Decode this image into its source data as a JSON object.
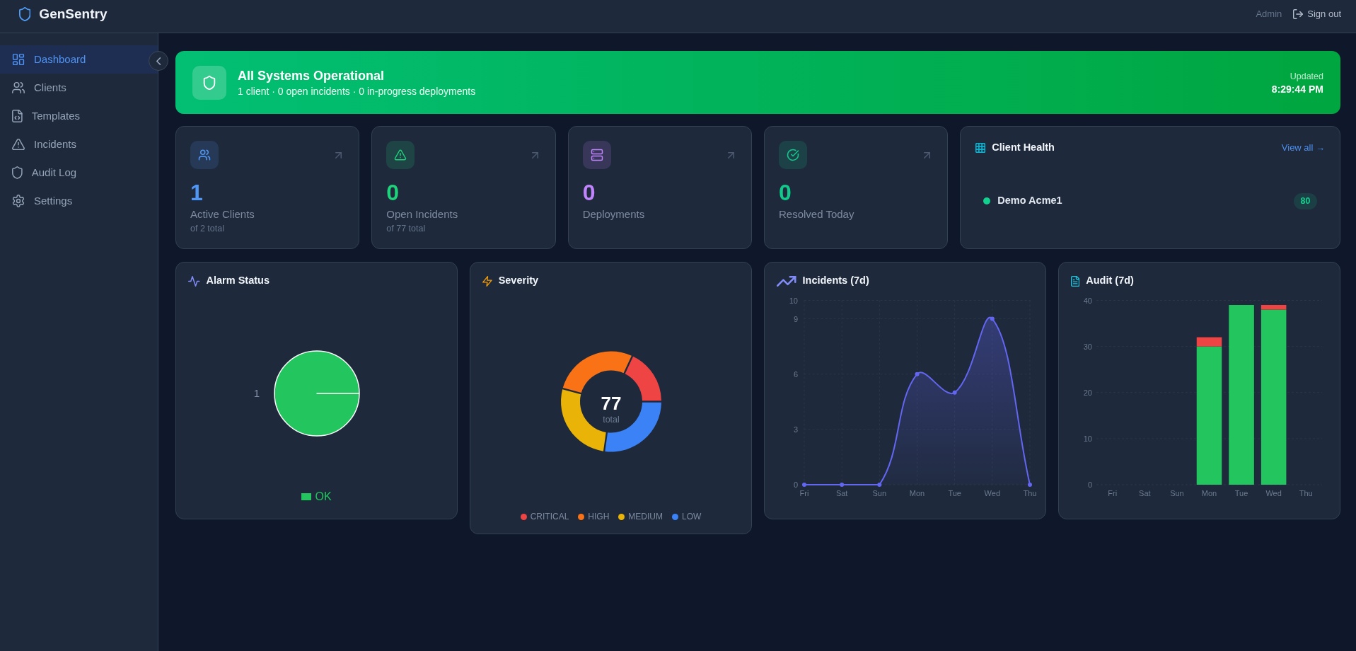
{
  "header": {
    "brand": "GenSentry",
    "user": "Admin",
    "sign_out": "Sign out"
  },
  "sidebar": {
    "items": [
      {
        "label": "Dashboard",
        "selected": true
      },
      {
        "label": "Clients",
        "selected": false
      },
      {
        "label": "Templates",
        "selected": false
      },
      {
        "label": "Incidents",
        "selected": false
      },
      {
        "label": "Audit Log",
        "selected": false
      },
      {
        "label": "Settings",
        "selected": false
      }
    ]
  },
  "banner": {
    "title": "All Systems Operational",
    "summary": "1 client · 0 open incidents · 0 in-progress deployments",
    "updated_label": "Updated",
    "updated_time": "8:29:44 PM"
  },
  "stats": [
    {
      "value": "1",
      "label": "Active Clients",
      "sub": "of 2 total",
      "color": "#4f96f5"
    },
    {
      "value": "0",
      "label": "Open Incidents",
      "sub": "of 77 total",
      "color": "#1fd17a"
    },
    {
      "value": "0",
      "label": "Deployments",
      "color": "#c084fc"
    },
    {
      "value": "0",
      "label": "Resolved Today",
      "color": "#12c98c"
    }
  ],
  "client_health": {
    "title": "Client Health",
    "link": "View all →",
    "clients": [
      {
        "name": "Demo Acme1",
        "score": "80",
        "color": "#12d18e"
      }
    ]
  },
  "alarm_status": {
    "title": "Alarm Status",
    "chart_data": {
      "type": "pie",
      "categories": [
        "OK"
      ],
      "values": [
        1
      ],
      "colors": [
        "#22c55e"
      ],
      "data_labels": true
    }
  },
  "severity": {
    "title": "Severity",
    "total": "77",
    "total_label": "total",
    "legend": [
      {
        "label": "CRITICAL",
        "color": "#ef4444"
      },
      {
        "label": "HIGH",
        "color": "#f97316"
      },
      {
        "label": "MEDIUM",
        "color": "#eab308"
      },
      {
        "label": "LOW",
        "color": "#3b82f6"
      }
    ]
  },
  "incidents": {
    "title": "Incidents (7d)",
    "chart_data": {
      "type": "area",
      "categories": [
        "Fri",
        "Sat",
        "Sun",
        "Mon",
        "Tue",
        "Wed",
        "Thu"
      ],
      "series": [
        {
          "color": "#6366f1",
          "values": [
            0,
            0,
            0,
            6,
            5,
            9,
            0
          ]
        }
      ],
      "ylim": [
        0,
        10
      ],
      "yticks": [
        0,
        3,
        6,
        9,
        10
      ],
      "grid": true
    }
  },
  "audit": {
    "title": "Audit (7d)",
    "chart_data": {
      "type": "bar",
      "stacked": true,
      "categories": [
        "Fri",
        "Sat",
        "Sun",
        "Mon",
        "Tue",
        "Wed",
        "Thu"
      ],
      "series": [
        {
          "color": "#22c55e",
          "values": [
            0,
            0,
            0,
            30,
            39,
            38,
            0
          ]
        },
        {
          "color": "#ef4444",
          "values": [
            0,
            0,
            0,
            2,
            0,
            1,
            0
          ]
        }
      ],
      "ylim": [
        0,
        40
      ],
      "yticks": [
        0,
        10,
        20,
        30,
        40
      ],
      "grid": true
    }
  }
}
